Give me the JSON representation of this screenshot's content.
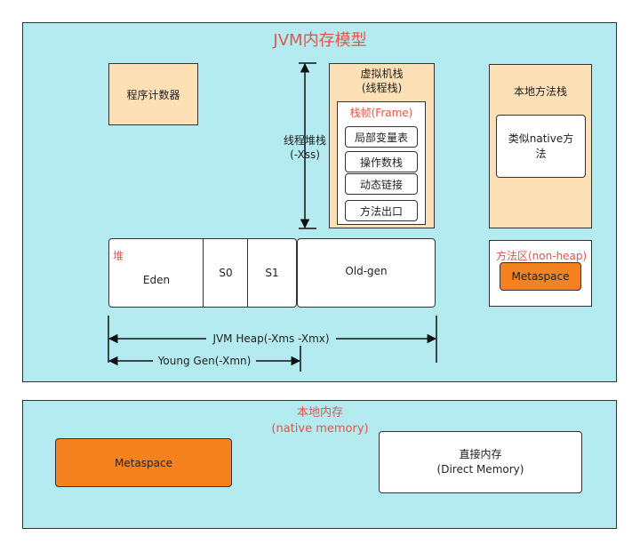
{
  "jvm": {
    "title": "JVM内存模型",
    "program_counter": "程序计数器",
    "vm_stack_title_1": "虚拟机栈",
    "vm_stack_title_2": "(线程栈)",
    "frame_title": "栈帧(Frame)",
    "frame_items": [
      "局部变量表",
      "操作数栈",
      "动态链接",
      "方法出口"
    ],
    "thread_stack_label_1": "线程堆栈",
    "thread_stack_label_2": "(-Xss)",
    "native_stack_title": "本地方法栈",
    "native_stack_box_1": "类似native方",
    "native_stack_box_2": "法",
    "heap_label": "堆",
    "heap_cells": [
      "Eden",
      "S0",
      "S1",
      "Old-gen"
    ],
    "method_area_title": "方法区(non-heap)",
    "method_area_metaspace": "Metaspace",
    "heap_dimension": "JVM Heap(-Xms -Xmx)",
    "young_dimension": "Young Gen(-Xmn)"
  },
  "native": {
    "title_1": "本地内存",
    "title_2": "(native memory)",
    "metaspace": "Metaspace",
    "direct_1": "直接内存",
    "direct_2": "(Direct Memory)"
  },
  "colors": {
    "panel": "#b3ebf0",
    "peach": "#fee0b6",
    "orange": "#f4821f",
    "title_red": "#e0564b"
  }
}
